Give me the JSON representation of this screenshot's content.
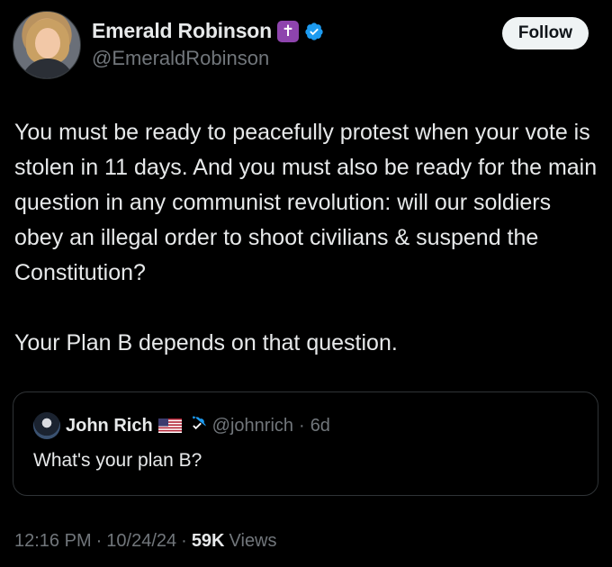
{
  "author": {
    "display_name": "Emerald Robinson",
    "handle": "@EmeraldRobinson",
    "emoji_badge": "✝",
    "verified": true
  },
  "follow_button": {
    "label": "Follow"
  },
  "tweet": {
    "paragraphs": [
      "You must be ready to peacefully protest when your vote is stolen in 11 days. And you must also be ready for the main question in any communist revolution: will our soldiers obey an illegal order to shoot civilians & suspend the Constitution?",
      "Your Plan B depends on that question."
    ]
  },
  "quoted_tweet": {
    "display_name": "John Rich",
    "handle": "@johnrich",
    "separator": "·",
    "age": "6d",
    "text": "What's your plan B?",
    "verified": true
  },
  "meta": {
    "time": "12:16 PM",
    "sep1": "·",
    "date": "10/24/24",
    "sep2": "·",
    "views_count": "59K",
    "views_label": "Views"
  },
  "colors": {
    "background": "#000000",
    "text": "#e7e9ea",
    "muted": "#71767b",
    "verified_blue": "#1d9bf0",
    "badge_purple": "#8e44ad"
  },
  "icons": [
    "avatar",
    "cross-badge",
    "verified-badge-icon",
    "us-flag-icon"
  ]
}
